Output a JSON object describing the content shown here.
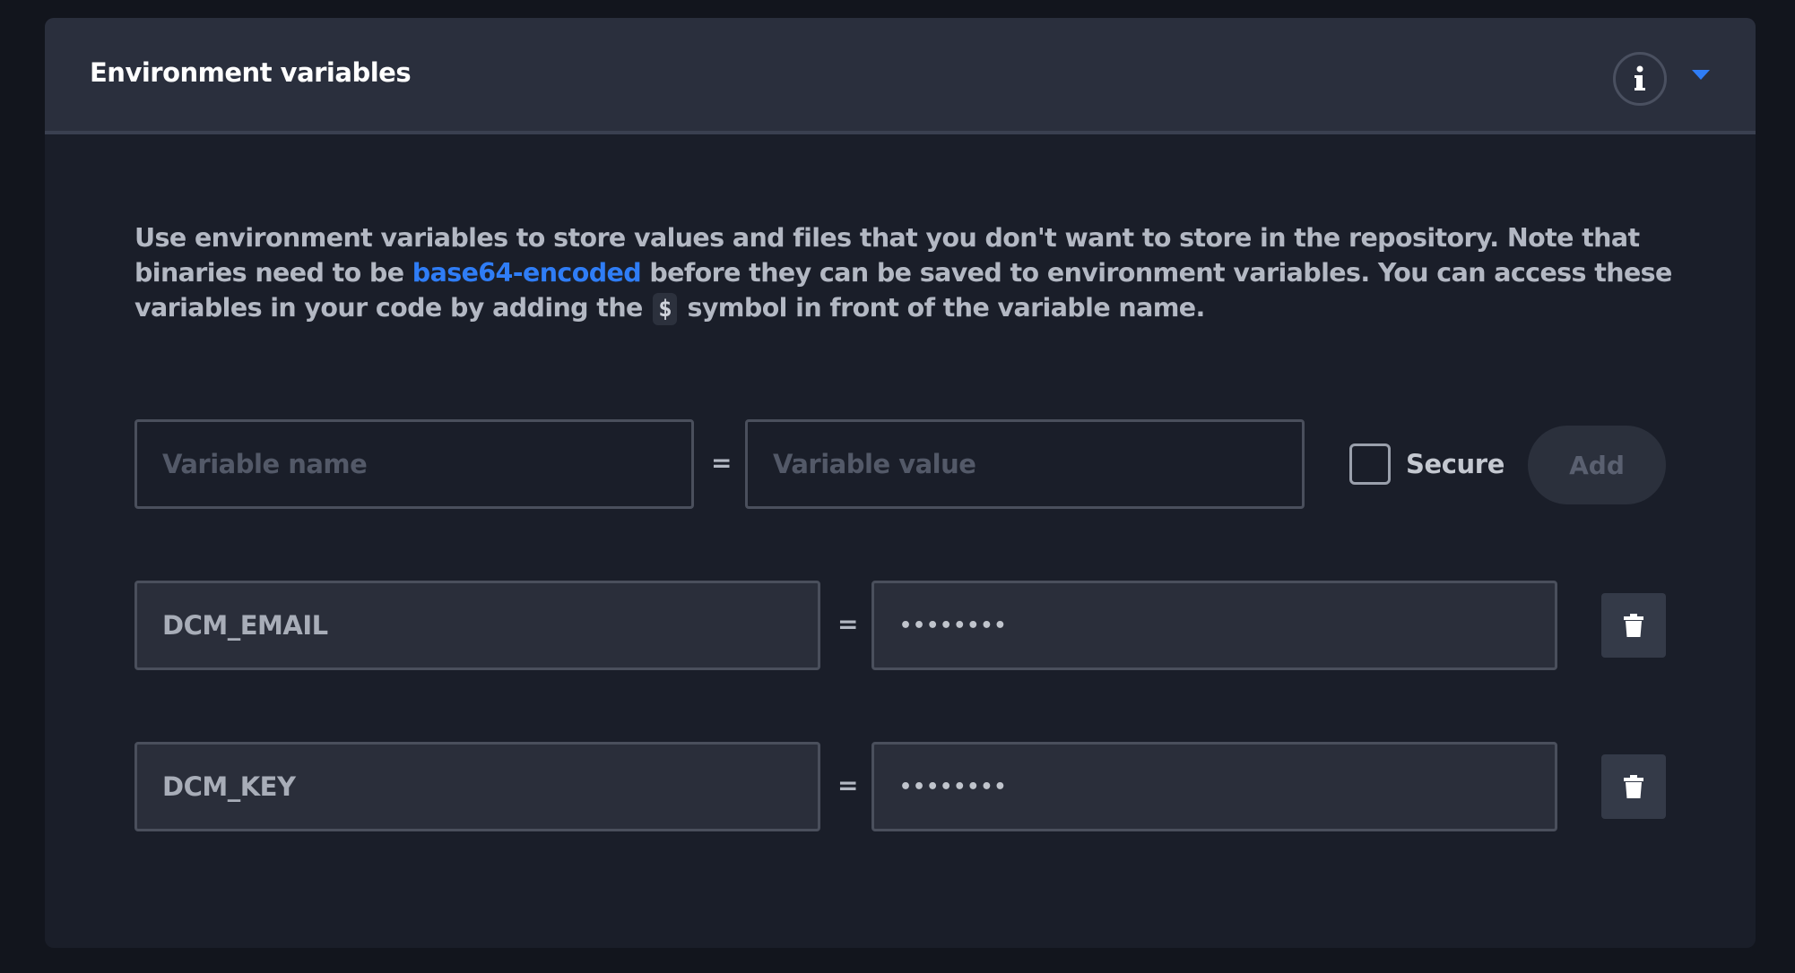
{
  "panel": {
    "title": "Environment variables"
  },
  "description": {
    "part1": "Use environment variables to store values and files that you don't want to store in the repository. Note that binaries need to be ",
    "link": "base64-encoded",
    "part2": " before they can be saved to environment variables. You can access these variables in your code by adding the ",
    "symbol": "$",
    "part3": " symbol in front of the variable name."
  },
  "new_variable": {
    "name_placeholder": "Variable name",
    "value_placeholder": "Variable value",
    "equals": "=",
    "secure_label": "Secure",
    "add_label": "Add"
  },
  "variables": [
    {
      "name": "DCM_EMAIL",
      "value": "••••••••",
      "equals": "="
    },
    {
      "name": "DCM_KEY",
      "value": "••••••••",
      "equals": "="
    }
  ],
  "colors": {
    "link": "#2f7df6",
    "chevron": "#2f7df6"
  }
}
